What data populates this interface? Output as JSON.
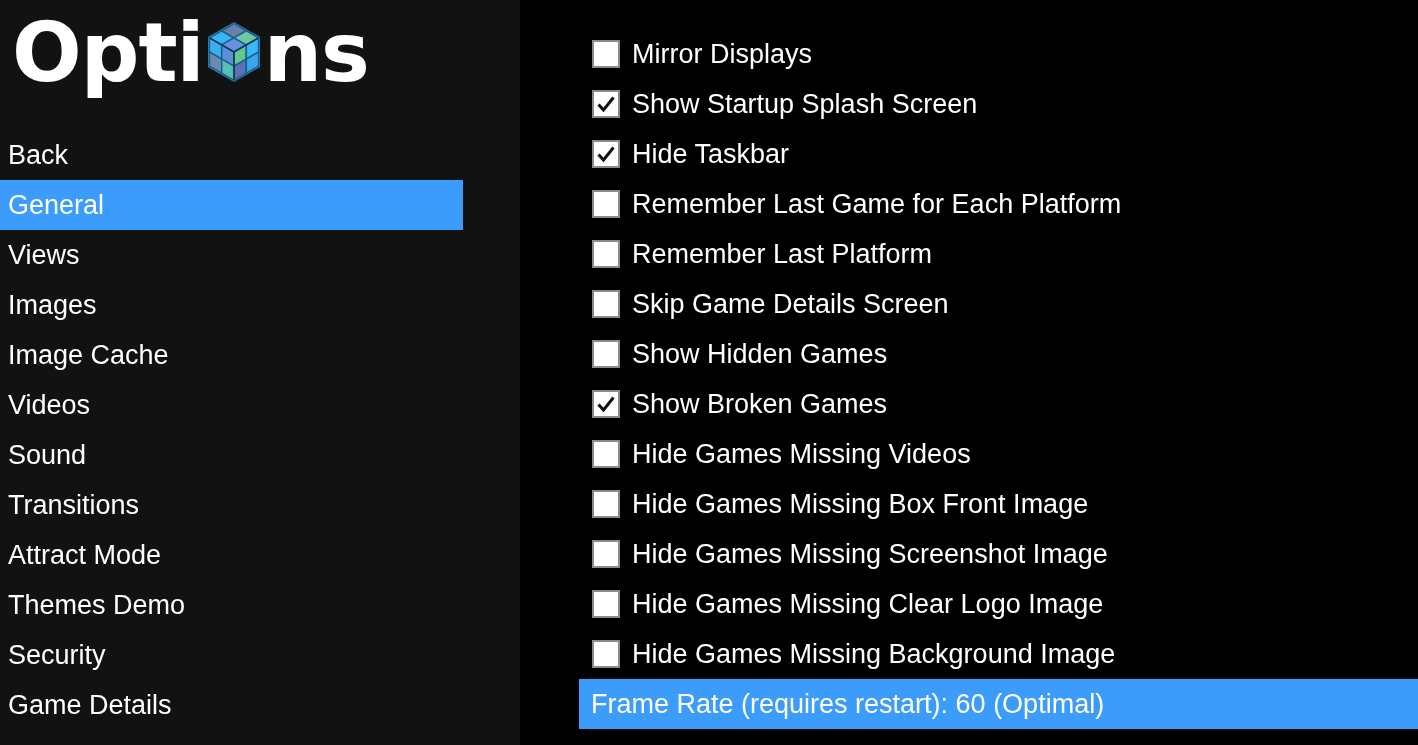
{
  "logo": {
    "text_before_icon": "Opti",
    "text_after_icon": "ns"
  },
  "sidebar": {
    "items": [
      {
        "label": "Back",
        "selected": false
      },
      {
        "label": "General",
        "selected": true
      },
      {
        "label": "Views",
        "selected": false
      },
      {
        "label": "Images",
        "selected": false
      },
      {
        "label": "Image Cache",
        "selected": false
      },
      {
        "label": "Videos",
        "selected": false
      },
      {
        "label": "Sound",
        "selected": false
      },
      {
        "label": "Transitions",
        "selected": false
      },
      {
        "label": "Attract Mode",
        "selected": false
      },
      {
        "label": "Themes Demo",
        "selected": false
      },
      {
        "label": "Security",
        "selected": false
      },
      {
        "label": "Game Details",
        "selected": false
      }
    ]
  },
  "settings": [
    {
      "kind": "checkbox",
      "label": "Mirror Displays",
      "checked": false,
      "selected": false
    },
    {
      "kind": "checkbox",
      "label": "Show Startup Splash Screen",
      "checked": true,
      "selected": false
    },
    {
      "kind": "checkbox",
      "label": "Hide Taskbar",
      "checked": true,
      "selected": false
    },
    {
      "kind": "checkbox",
      "label": "Remember Last Game for Each Platform",
      "checked": false,
      "selected": false
    },
    {
      "kind": "checkbox",
      "label": "Remember Last Platform",
      "checked": false,
      "selected": false
    },
    {
      "kind": "checkbox",
      "label": "Skip Game Details Screen",
      "checked": false,
      "selected": false
    },
    {
      "kind": "checkbox",
      "label": "Show Hidden Games",
      "checked": false,
      "selected": false
    },
    {
      "kind": "checkbox",
      "label": "Show Broken Games",
      "checked": true,
      "selected": false
    },
    {
      "kind": "checkbox",
      "label": "Hide Games Missing Videos",
      "checked": false,
      "selected": false
    },
    {
      "kind": "checkbox",
      "label": "Hide Games Missing Box Front Image",
      "checked": false,
      "selected": false
    },
    {
      "kind": "checkbox",
      "label": "Hide Games Missing Screenshot Image",
      "checked": false,
      "selected": false
    },
    {
      "kind": "checkbox",
      "label": "Hide Games Missing Clear Logo Image",
      "checked": false,
      "selected": false
    },
    {
      "kind": "checkbox",
      "label": "Hide Games Missing Background Image",
      "checked": false,
      "selected": false
    },
    {
      "kind": "value",
      "label": "Frame Rate (requires restart): 60 (Optimal)",
      "selected": true
    }
  ]
}
